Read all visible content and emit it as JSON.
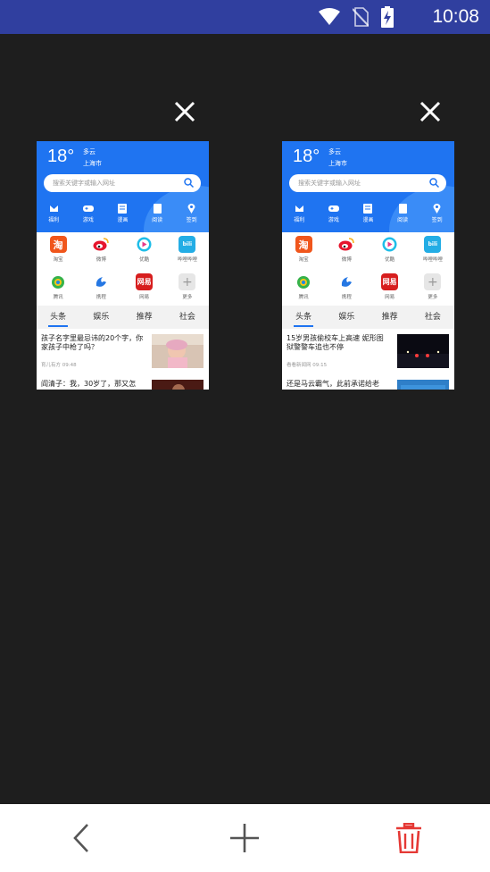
{
  "status_bar": {
    "time": "10:08",
    "icons": [
      "wifi-icon",
      "no-sim-icon",
      "battery-charging-icon"
    ],
    "background": "#303f9f"
  },
  "tabs": [
    {
      "weather": {
        "temp": "18°",
        "condition": "多云",
        "city": "上海市"
      },
      "search_placeholder": "搜索关键字或输入网址",
      "quick_links": [
        "福利",
        "游戏",
        "漫画",
        "阅读",
        "签到"
      ],
      "apps": [
        {
          "icon_text": "淘",
          "label": "淘宝",
          "color": "#f0561c"
        },
        {
          "icon_text": "",
          "label": "微博",
          "color": "#f6b11a"
        },
        {
          "icon_text": "",
          "label": "优酷",
          "color": "#ffffff"
        },
        {
          "icon_text": "bili",
          "label": "哔哩哔哩",
          "color": "#23ade5"
        },
        {
          "icon_text": "",
          "label": "腾讯",
          "color": "#ffffff"
        },
        {
          "icon_text": "",
          "label": "携程",
          "color": "#ffffff"
        },
        {
          "icon_text": "网易",
          "label": "网易",
          "color": "#d71e1e"
        },
        {
          "icon_text": "+",
          "label": "更多",
          "color": "#dddddd"
        }
      ],
      "news_tabs": [
        "头条",
        "娱乐",
        "推荐",
        "社会"
      ],
      "news": [
        {
          "title": "孩子名字里最忌讳的20个字，你家孩子中枪了吗？",
          "meta": "育儿有方  09:48"
        },
        {
          "title": "阎清子：我，30岁了，那又怎"
        }
      ]
    },
    {
      "weather": {
        "temp": "18°",
        "condition": "多云",
        "city": "上海市"
      },
      "search_placeholder": "搜索关键字或输入网址",
      "quick_links": [
        "福利",
        "游戏",
        "漫画",
        "阅读",
        "签到"
      ],
      "apps": [
        {
          "icon_text": "淘",
          "label": "淘宝",
          "color": "#f0561c"
        },
        {
          "icon_text": "",
          "label": "微博",
          "color": "#f6b11a"
        },
        {
          "icon_text": "",
          "label": "优酷",
          "color": "#ffffff"
        },
        {
          "icon_text": "bili",
          "label": "哔哩哔哩",
          "color": "#23ade5"
        },
        {
          "icon_text": "",
          "label": "腾讯",
          "color": "#ffffff"
        },
        {
          "icon_text": "",
          "label": "携程",
          "color": "#ffffff"
        },
        {
          "icon_text": "网易",
          "label": "网易",
          "color": "#d71e1e"
        },
        {
          "icon_text": "+",
          "label": "更多",
          "color": "#dddddd"
        }
      ],
      "news_tabs": [
        "头条",
        "娱乐",
        "推荐",
        "社会"
      ],
      "news": [
        {
          "title": "15岁男孩偷校车上高速 妮形图 狱警警车追也不停",
          "meta": "看看新闻网  09:15"
        },
        {
          "title": "还是马云霸气，此前承诺给老"
        }
      ]
    }
  ],
  "bottom_bar": {
    "buttons": [
      "back-icon",
      "add-tab-icon",
      "delete-all-icon"
    ],
    "delete_color": "#e53935"
  }
}
